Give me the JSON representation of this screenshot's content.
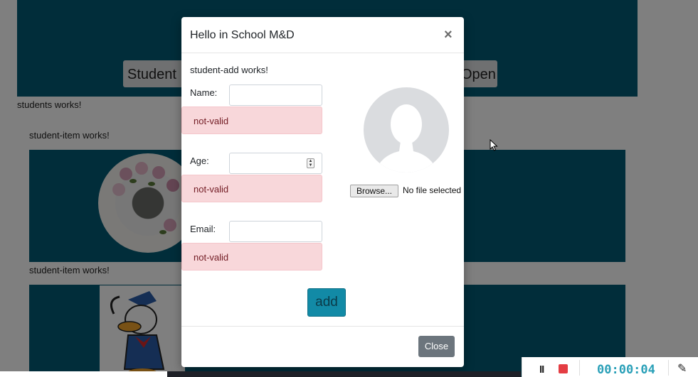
{
  "background_page": {
    "left_button_label": "Student",
    "right_button_label": "Open",
    "students_text": "students works!",
    "item_text_1": "student-item works!",
    "item_text_2": "student-item works!"
  },
  "modal": {
    "title": "Hello in School M&D",
    "close_symbol": "×",
    "intro_text": "student-add works!",
    "fields": [
      {
        "label": "Name:",
        "value": "",
        "error": "not-valid"
      },
      {
        "label": "Age:",
        "value": "",
        "error": "not-valid"
      },
      {
        "label": "Email:",
        "value": "",
        "error": "not-valid"
      }
    ],
    "file": {
      "button_label": "Browse...",
      "status": "No file selected"
    },
    "add_label": "add",
    "footer_close_label": "Close"
  },
  "recorder": {
    "pause_symbol": "II",
    "timer": "00:00:04"
  },
  "colors": {
    "teal_bg": "#025b75",
    "alert_bg": "#f8d7da",
    "alert_text": "#721c24",
    "add_btn": "#128aa6",
    "close_btn": "#6c757d",
    "timer": "#2aa0b8",
    "stop": "#e43d43"
  }
}
